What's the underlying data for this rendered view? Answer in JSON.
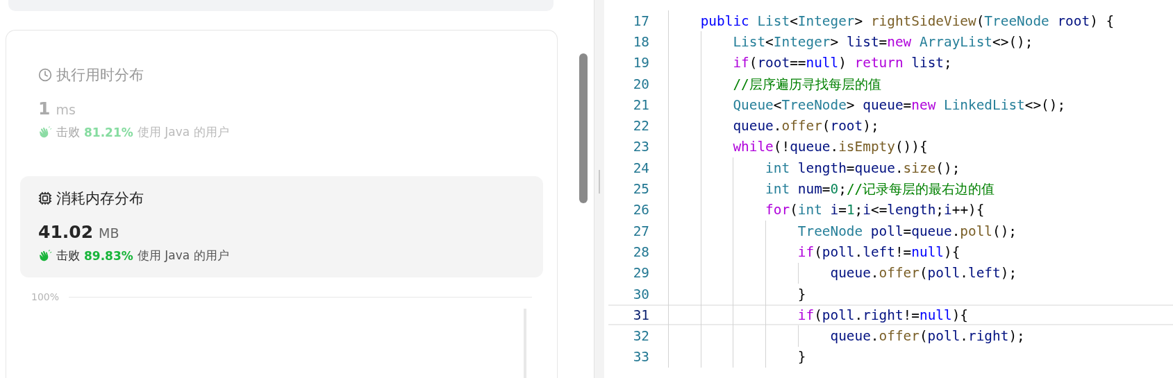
{
  "stats": [
    {
      "kind": "runtime",
      "selected": false,
      "title": "执行用时分布",
      "value": "1",
      "unit": "ms",
      "beats_label": "击败",
      "beats_percent": "81.21%",
      "beats_suffix": "使用 Java 的用户"
    },
    {
      "kind": "memory",
      "selected": true,
      "title": "消耗内存分布",
      "value": "41.02",
      "unit": "MB",
      "beats_label": "击败",
      "beats_percent": "89.83%",
      "beats_suffix": "使用 Java 的用户"
    }
  ],
  "chart": {
    "y_tick": "100%"
  },
  "code": {
    "lines": [
      {
        "number": "17",
        "current": false,
        "tokens": [
          {
            "text": "    public",
            "kind": "kw"
          },
          {
            "text": " List",
            "kind": "type"
          },
          {
            "text": "<",
            "kind": "p"
          },
          {
            "text": "Integer",
            "kind": "type"
          },
          {
            "text": "> ",
            "kind": "p"
          },
          {
            "text": "rightSideView",
            "kind": "fn"
          },
          {
            "text": "(",
            "kind": "p"
          },
          {
            "text": "TreeNode",
            "kind": "type"
          },
          {
            "text": " root",
            "kind": "var"
          },
          {
            "text": ") {",
            "kind": "p"
          }
        ]
      },
      {
        "number": "18",
        "current": false,
        "tokens": [
          {
            "text": "        List",
            "kind": "type"
          },
          {
            "text": "<",
            "kind": "p"
          },
          {
            "text": "Integer",
            "kind": "type"
          },
          {
            "text": "> ",
            "kind": "p"
          },
          {
            "text": "list",
            "kind": "var"
          },
          {
            "text": "=",
            "kind": "p"
          },
          {
            "text": "new",
            "kind": "ctrl"
          },
          {
            "text": " ArrayList",
            "kind": "type"
          },
          {
            "text": "<>();",
            "kind": "p"
          }
        ]
      },
      {
        "number": "19",
        "current": false,
        "tokens": [
          {
            "text": "        if",
            "kind": "ctrl"
          },
          {
            "text": "(",
            "kind": "p"
          },
          {
            "text": "root",
            "kind": "var"
          },
          {
            "text": "==",
            "kind": "p"
          },
          {
            "text": "null",
            "kind": "kw"
          },
          {
            "text": ") ",
            "kind": "p"
          },
          {
            "text": "return",
            "kind": "ctrl"
          },
          {
            "text": " list",
            "kind": "var"
          },
          {
            "text": ";",
            "kind": "p"
          }
        ]
      },
      {
        "number": "20",
        "current": false,
        "tokens": [
          {
            "text": "        //层序遍历寻找每层的值",
            "kind": "comment"
          }
        ]
      },
      {
        "number": "21",
        "current": false,
        "tokens": [
          {
            "text": "        Queue",
            "kind": "type"
          },
          {
            "text": "<",
            "kind": "p"
          },
          {
            "text": "TreeNode",
            "kind": "type"
          },
          {
            "text": "> ",
            "kind": "p"
          },
          {
            "text": "queue",
            "kind": "var"
          },
          {
            "text": "=",
            "kind": "p"
          },
          {
            "text": "new",
            "kind": "ctrl"
          },
          {
            "text": " LinkedList",
            "kind": "type"
          },
          {
            "text": "<>();",
            "kind": "p"
          }
        ]
      },
      {
        "number": "22",
        "current": false,
        "tokens": [
          {
            "text": "        queue",
            "kind": "var"
          },
          {
            "text": ".",
            "kind": "p"
          },
          {
            "text": "offer",
            "kind": "fn"
          },
          {
            "text": "(",
            "kind": "p"
          },
          {
            "text": "root",
            "kind": "var"
          },
          {
            "text": ");",
            "kind": "p"
          }
        ]
      },
      {
        "number": "23",
        "current": false,
        "tokens": [
          {
            "text": "        while",
            "kind": "ctrl"
          },
          {
            "text": "(!",
            "kind": "p"
          },
          {
            "text": "queue",
            "kind": "var"
          },
          {
            "text": ".",
            "kind": "p"
          },
          {
            "text": "isEmpty",
            "kind": "fn"
          },
          {
            "text": "()){",
            "kind": "p"
          }
        ]
      },
      {
        "number": "24",
        "current": false,
        "tokens": [
          {
            "text": "            int",
            "kind": "type"
          },
          {
            "text": " length",
            "kind": "var"
          },
          {
            "text": "=",
            "kind": "p"
          },
          {
            "text": "queue",
            "kind": "var"
          },
          {
            "text": ".",
            "kind": "p"
          },
          {
            "text": "size",
            "kind": "fn"
          },
          {
            "text": "();",
            "kind": "p"
          }
        ]
      },
      {
        "number": "25",
        "current": false,
        "tokens": [
          {
            "text": "            int",
            "kind": "type"
          },
          {
            "text": " num",
            "kind": "var"
          },
          {
            "text": "=",
            "kind": "p"
          },
          {
            "text": "0",
            "kind": "num"
          },
          {
            "text": ";",
            "kind": "p"
          },
          {
            "text": "//记录每层的最右边的值",
            "kind": "comment"
          }
        ]
      },
      {
        "number": "26",
        "current": false,
        "tokens": [
          {
            "text": "            for",
            "kind": "ctrl"
          },
          {
            "text": "(",
            "kind": "p"
          },
          {
            "text": "int",
            "kind": "type"
          },
          {
            "text": " i",
            "kind": "var"
          },
          {
            "text": "=",
            "kind": "p"
          },
          {
            "text": "1",
            "kind": "num"
          },
          {
            "text": ";",
            "kind": "p"
          },
          {
            "text": "i",
            "kind": "var"
          },
          {
            "text": "<=",
            "kind": "p"
          },
          {
            "text": "length",
            "kind": "var"
          },
          {
            "text": ";",
            "kind": "p"
          },
          {
            "text": "i",
            "kind": "var"
          },
          {
            "text": "++){",
            "kind": "p"
          }
        ]
      },
      {
        "number": "27",
        "current": false,
        "tokens": [
          {
            "text": "                TreeNode",
            "kind": "type"
          },
          {
            "text": " poll",
            "kind": "var"
          },
          {
            "text": "=",
            "kind": "p"
          },
          {
            "text": "queue",
            "kind": "var"
          },
          {
            "text": ".",
            "kind": "p"
          },
          {
            "text": "poll",
            "kind": "fn"
          },
          {
            "text": "();",
            "kind": "p"
          }
        ]
      },
      {
        "number": "28",
        "current": false,
        "tokens": [
          {
            "text": "                if",
            "kind": "ctrl"
          },
          {
            "text": "(",
            "kind": "p"
          },
          {
            "text": "poll",
            "kind": "var"
          },
          {
            "text": ".",
            "kind": "p"
          },
          {
            "text": "left",
            "kind": "var"
          },
          {
            "text": "!=",
            "kind": "p"
          },
          {
            "text": "null",
            "kind": "kw"
          },
          {
            "text": "){",
            "kind": "p"
          }
        ]
      },
      {
        "number": "29",
        "current": false,
        "tokens": [
          {
            "text": "                    queue",
            "kind": "var"
          },
          {
            "text": ".",
            "kind": "p"
          },
          {
            "text": "offer",
            "kind": "fn"
          },
          {
            "text": "(",
            "kind": "p"
          },
          {
            "text": "poll",
            "kind": "var"
          },
          {
            "text": ".",
            "kind": "p"
          },
          {
            "text": "left",
            "kind": "var"
          },
          {
            "text": ");",
            "kind": "p"
          }
        ]
      },
      {
        "number": "30",
        "current": false,
        "tokens": [
          {
            "text": "                }",
            "kind": "p"
          }
        ]
      },
      {
        "number": "31",
        "current": true,
        "tokens": [
          {
            "text": "                if",
            "kind": "ctrl"
          },
          {
            "text": "(",
            "kind": "p"
          },
          {
            "text": "poll",
            "kind": "var"
          },
          {
            "text": ".",
            "kind": "p"
          },
          {
            "text": "right",
            "kind": "var"
          },
          {
            "text": "!=",
            "kind": "p"
          },
          {
            "text": "null",
            "kind": "kw"
          },
          {
            "text": "){",
            "kind": "p"
          }
        ]
      },
      {
        "number": "32",
        "current": false,
        "tokens": [
          {
            "text": "                    queue",
            "kind": "var"
          },
          {
            "text": ".",
            "kind": "p"
          },
          {
            "text": "offer",
            "kind": "fn"
          },
          {
            "text": "(",
            "kind": "p"
          },
          {
            "text": "poll",
            "kind": "var"
          },
          {
            "text": ".",
            "kind": "p"
          },
          {
            "text": "right",
            "kind": "var"
          },
          {
            "text": ");",
            "kind": "p"
          }
        ]
      },
      {
        "number": "33",
        "current": false,
        "tokens": [
          {
            "text": "                }",
            "kind": "p"
          }
        ]
      }
    ]
  }
}
